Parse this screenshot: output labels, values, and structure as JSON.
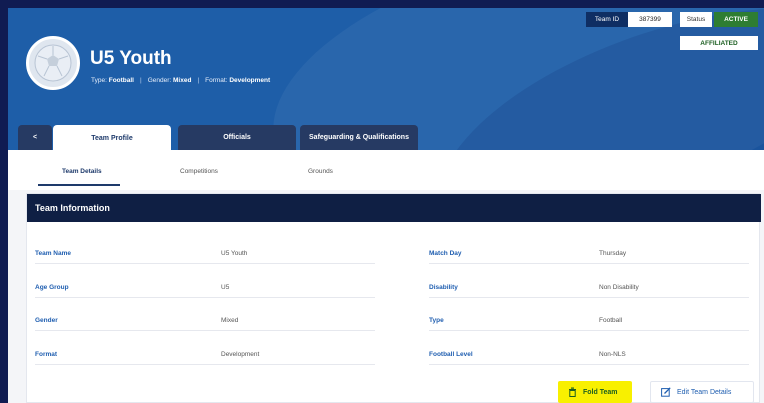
{
  "header": {
    "title": "U5 Youth",
    "meta": {
      "type_label": "Type:",
      "type_value": "Football",
      "gender_label": "Gender:",
      "gender_value": "Mixed",
      "format_label": "Format:",
      "format_value": "Development"
    },
    "team_id_label": "Team ID",
    "team_id_value": "387399",
    "status_label": "Status",
    "status_value": "ACTIVE",
    "affiliation_badge": "AFFILIATED"
  },
  "tabs": [
    {
      "label": "<"
    },
    {
      "label": "Team Profile"
    },
    {
      "label": "Officials"
    },
    {
      "label": "Safeguarding & Qualifications"
    }
  ],
  "subtabs": [
    {
      "label": "Team Details"
    },
    {
      "label": "Competitions"
    },
    {
      "label": "Grounds"
    }
  ],
  "card": {
    "title": "Team Information",
    "left_fields": [
      {
        "label": "Team Name",
        "value": "U5 Youth"
      },
      {
        "label": "Age Group",
        "value": "U5"
      },
      {
        "label": "Gender",
        "value": "Mixed"
      },
      {
        "label": "Format",
        "value": "Development"
      }
    ],
    "right_fields": [
      {
        "label": "Match Day",
        "value": "Thursday"
      },
      {
        "label": "Disability",
        "value": "Non Disability"
      },
      {
        "label": "Type",
        "value": "Football"
      },
      {
        "label": "Football Level",
        "value": "Non-NLS"
      }
    ]
  },
  "actions": {
    "fold_label": "Fold Team",
    "edit_label": "Edit Team Details"
  },
  "icons": {
    "avatar": "football-icon",
    "fold": "trash-icon",
    "edit": "edit-icon"
  },
  "colors": {
    "banner": "#1e5ea8",
    "status_active": "#2e7d32",
    "card_header": "#0f1f44",
    "fold_button": "#f8f000",
    "label_blue": "#1f5eb0"
  }
}
